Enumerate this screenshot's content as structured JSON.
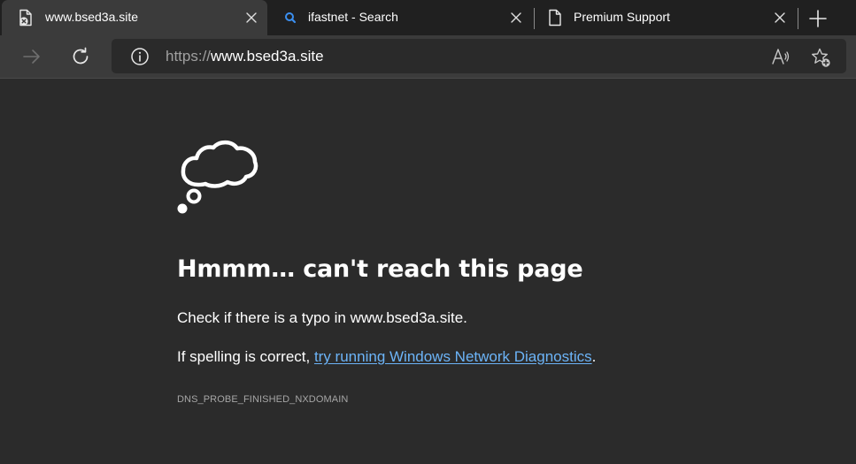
{
  "tabs": [
    {
      "title": "www.bsed3a.site",
      "icon": "page-error-icon",
      "active": true
    },
    {
      "title": "ifastnet - Search",
      "icon": "search-icon",
      "active": false
    },
    {
      "title": "Premium Support",
      "icon": "page-icon",
      "active": false
    }
  ],
  "toolbar": {
    "url_scheme": "https://",
    "url_host": "www.bsed3a.site"
  },
  "error_page": {
    "heading": "Hmmm… can't reach this page",
    "line1": "Check if there is a typo in www.bsed3a.site.",
    "line2_prefix": "If spelling is correct, ",
    "line2_link": "try running Windows Network Diagnostics",
    "line2_suffix": ".",
    "error_code": "DNS_PROBE_FINISHED_NXDOMAIN"
  },
  "colors": {
    "page_background": "#2b2b2b",
    "tabstrip_background": "#202020",
    "toolbar_background": "#3b3b3b",
    "link": "#6cb4f8",
    "search_icon": "#3b8ff0"
  }
}
